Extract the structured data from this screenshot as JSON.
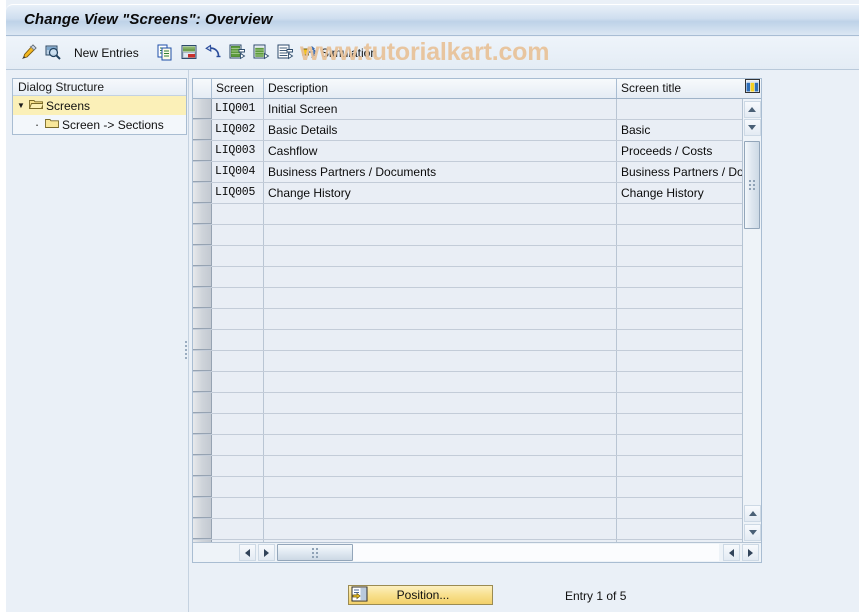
{
  "window": {
    "title": "Change View \"Screens\": Overview"
  },
  "watermark": {
    "text": "www.tutorialkart.com",
    "color": "#e8c39b"
  },
  "toolbar": {
    "items": [
      {
        "name": "change-display-icon",
        "label": "",
        "icon": "pencil-icon"
      },
      {
        "name": "display-details-icon",
        "label": "",
        "icon": "magnifier-icon"
      },
      {
        "name": "new-entries-button",
        "label": "New Entries",
        "icon": ""
      },
      {
        "name": "copy-icon",
        "label": "",
        "icon": "copy-icon"
      },
      {
        "name": "save-icon",
        "label": "",
        "icon": "save-icon"
      },
      {
        "name": "undo-icon",
        "label": "",
        "icon": "undo-icon"
      },
      {
        "name": "select-all-icon",
        "label": "",
        "icon": "select-all-icon"
      },
      {
        "name": "deselect-all-icon",
        "label": "",
        "icon": "deselect-all-icon"
      },
      {
        "name": "select-block-icon",
        "label": "",
        "icon": "select-block-icon"
      },
      {
        "name": "simulation-button",
        "label": "Simulation",
        "icon": "transport-icon"
      }
    ]
  },
  "sidebar": {
    "header": "Dialog Structure",
    "items": [
      {
        "label": "Screens",
        "selected": true,
        "level": 0
      },
      {
        "label": "Screen -> Sections",
        "selected": false,
        "level": 1
      }
    ]
  },
  "table": {
    "columns": [
      {
        "key": "screen",
        "label": "Screen"
      },
      {
        "key": "description",
        "label": "Description"
      },
      {
        "key": "screen_title",
        "label": "Screen title"
      }
    ],
    "rows": [
      {
        "screen": "LIQ001",
        "description": "Initial Screen",
        "screen_title": ""
      },
      {
        "screen": "LIQ002",
        "description": "Basic Details",
        "screen_title": "Basic"
      },
      {
        "screen": "LIQ003",
        "description": "Cashflow",
        "screen_title": "Proceeds / Costs"
      },
      {
        "screen": "LIQ004",
        "description": "Business Partners / Documents",
        "screen_title": "Business Partners / Doc"
      },
      {
        "screen": "LIQ005",
        "description": "Change History",
        "screen_title": "Change History"
      }
    ],
    "empty_row_count": 19,
    "config_icon": "column-config-icon"
  },
  "footer": {
    "position_button": "Position...",
    "entry_status": "Entry 1 of 5"
  }
}
